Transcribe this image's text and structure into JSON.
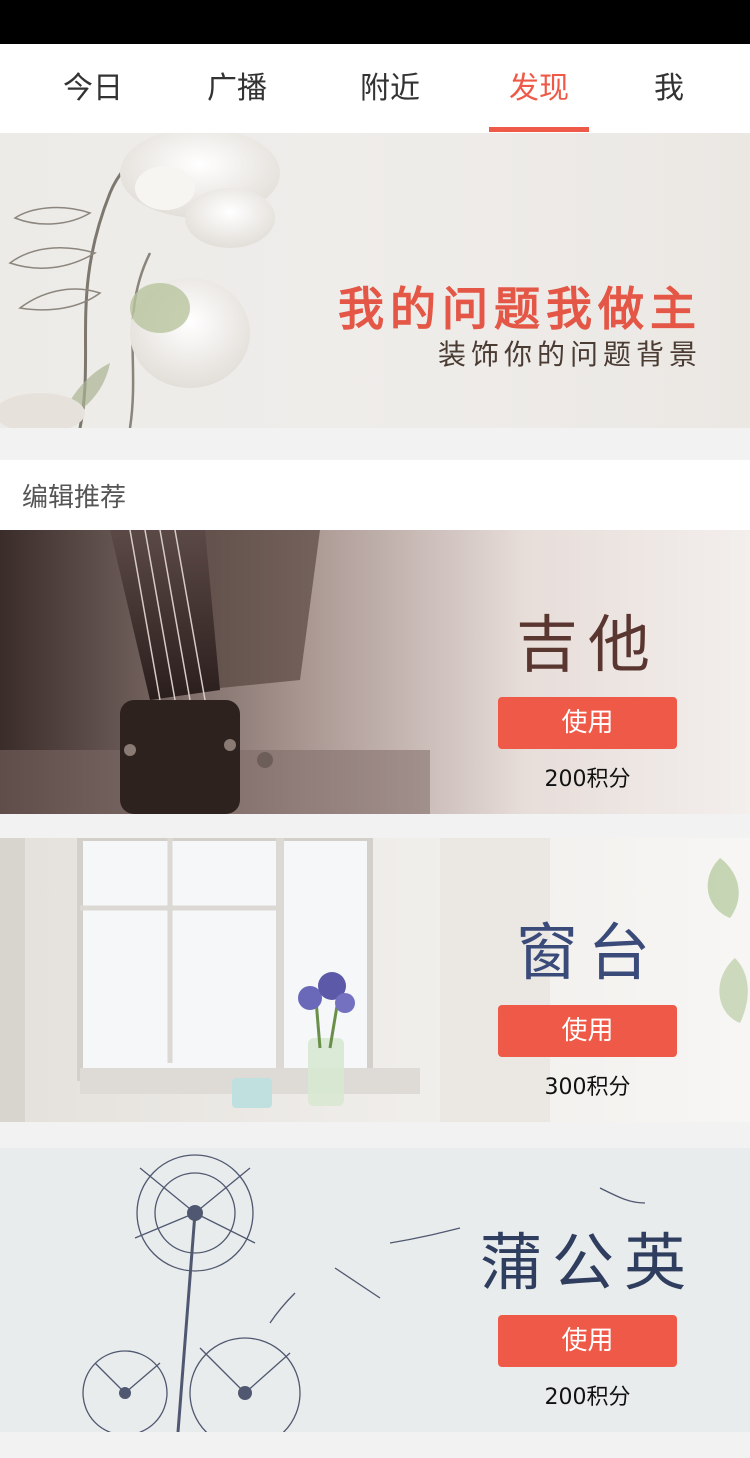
{
  "tabs": [
    {
      "label": "今日"
    },
    {
      "label": "广播"
    },
    {
      "label": "附近"
    },
    {
      "label": "发现"
    },
    {
      "label": "我"
    }
  ],
  "active_tab": "发现",
  "banner": {
    "title": "我的问题我做主",
    "subtitle": "装饰你的问题背景"
  },
  "section": {
    "title": "编辑推荐"
  },
  "cards": [
    {
      "name": "吉他",
      "button_label": "使用",
      "points": "200积分",
      "name_color": "#5a3630"
    },
    {
      "name": "窗台",
      "button_label": "使用",
      "points": "300积分",
      "name_color": "#3a4b7a"
    },
    {
      "name": "蒲公英",
      "button_label": "使用",
      "points": "200积分",
      "name_color": "#2f3d5e"
    }
  ],
  "colors": {
    "accent": "#ef5a48",
    "status_bar": "#000000"
  }
}
